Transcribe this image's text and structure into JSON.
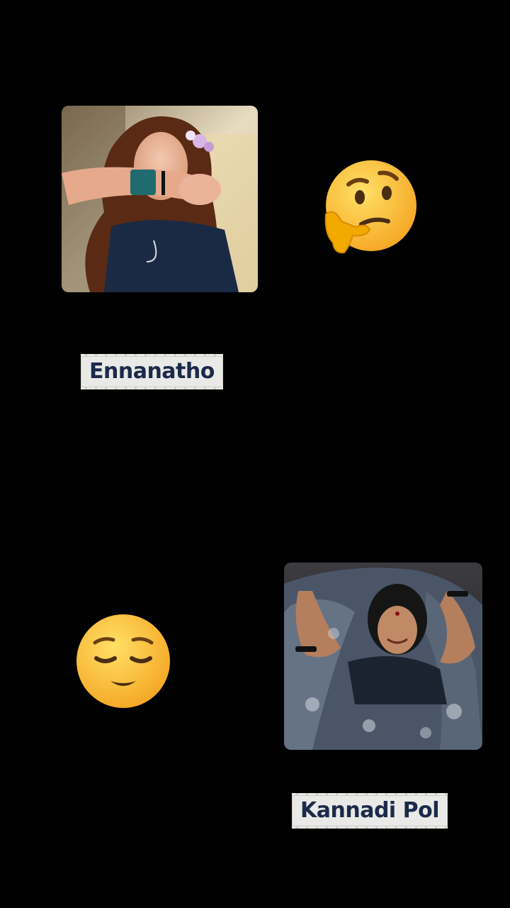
{
  "posts": [
    {
      "caption": "Ennanatho",
      "reaction_icon": "thinking-face-icon",
      "photo_colors": {
        "hair": "#5a2a14",
        "dress": "#1a2a44",
        "skin": "#e8b49a",
        "bg": "#d9c9a8"
      }
    },
    {
      "caption": "Kannadi Pol",
      "reaction_icon": "relieved-face-icon",
      "photo_colors": {
        "saree": "#4a5668",
        "skin": "#c08a66",
        "hair": "#151515",
        "bg": "#2e2e30"
      }
    }
  ],
  "colors": {
    "background": "#000000",
    "caption_bg": "#e9e9e7",
    "caption_text": "#1b2a4a",
    "emoji_yellow": "#ffcc33"
  }
}
